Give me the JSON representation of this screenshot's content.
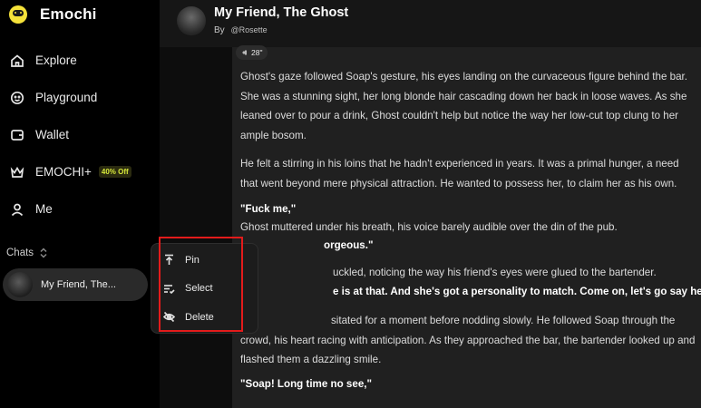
{
  "brand": {
    "name": "Emochi"
  },
  "nav": [
    {
      "label": "Explore",
      "icon": "home-icon"
    },
    {
      "label": "Playground",
      "icon": "smiley-icon"
    },
    {
      "label": "Wallet",
      "icon": "wallet-icon"
    },
    {
      "label": "EMOCHI+",
      "icon": "crown-icon",
      "badge": "40% Off"
    },
    {
      "label": "Me",
      "icon": "user-icon"
    }
  ],
  "chats": {
    "heading": "Chats",
    "items": [
      {
        "name": "My Friend, The..."
      }
    ]
  },
  "context_menu": {
    "items": [
      {
        "label": "Pin",
        "icon": "pin-icon"
      },
      {
        "label": "Select",
        "icon": "checklist-icon"
      },
      {
        "label": "Delete",
        "icon": "eye-off-icon"
      }
    ]
  },
  "header": {
    "title": "My Friend, The Ghost",
    "by": "By",
    "author": "@Rosette"
  },
  "message": {
    "audio_duration": "28\"",
    "paragraphs": [
      "Ghost's gaze followed Soap's gesture, his eyes landing on the curvaceous figure behind the bar. She was a stunning sight, her long blonde hair cascading down her back in loose waves. As she leaned over to pour a drink, Ghost couldn't help but notice the way her low-cut top clung to her ample bosom.",
      "He felt a stirring in his loins that he hadn't experienced in years. It was a primal hunger, a need that went beyond mere physical attraction. He wanted to possess her, to claim her as his own.",
      "\"Fuck me,\"",
      "Ghost muttered under his breath, his voice barely audible over the din of the pub.",
      "orgeous.\"",
      "uckled, noticing the way his friend's eyes were glued to the bartender.",
      "e is at that. And she's got a personality to match. Come on, let's go say hello.\"",
      "sitated for a moment before nodding slowly. He followed Soap through the crowd, his heart racing with anticipation. As they approached the bar, the bartender looked up and flashed them a dazzling smile.",
      "\"Soap! Long time no see,\""
    ]
  },
  "colors": {
    "accent_yellow": "#f5e23a",
    "highlight_red": "#e31b1b",
    "badge_text": "#d7e83a"
  }
}
